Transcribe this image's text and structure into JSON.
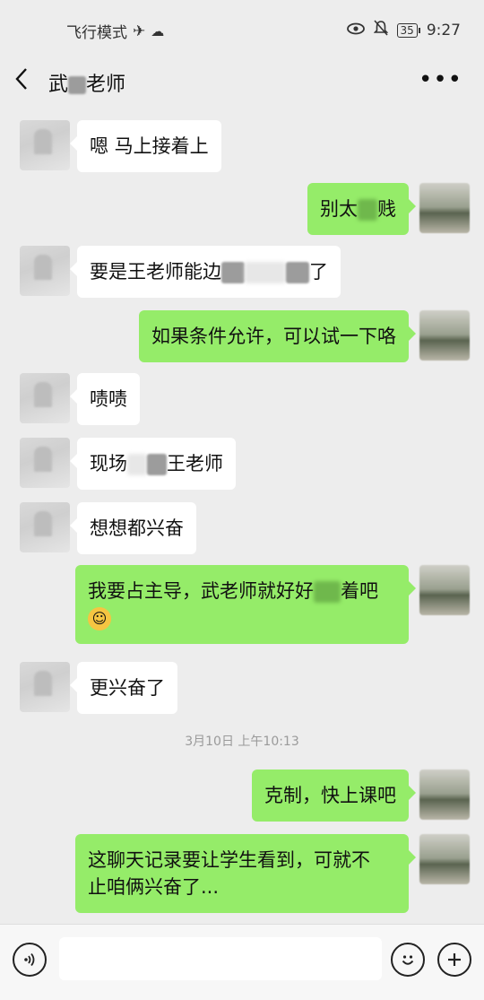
{
  "status_bar": {
    "airplane_mode": "飞行模式",
    "time": "9:27",
    "battery": "35",
    "icons": [
      "airplane-icon",
      "cloud-icon",
      "eye-icon",
      "mute-icon",
      "battery-icon"
    ]
  },
  "header": {
    "title": "武",
    "title_end": "老师",
    "icons": [
      "back-arrow-icon",
      "more-icon"
    ]
  },
  "messages": [
    {
      "side": "in",
      "text": "嗯 马上接着上"
    },
    {
      "side": "out",
      "text_a": "别太",
      "text_b": "贱"
    },
    {
      "side": "in",
      "text_a": "要是王老师能边",
      "text_b": "了"
    },
    {
      "side": "out",
      "text": "如果条件允许，可以试一下咯"
    },
    {
      "side": "in",
      "text": "啧啧"
    },
    {
      "side": "in",
      "text_a": "现场",
      "text_b": "王老师"
    },
    {
      "side": "in",
      "text": "想想都兴奋"
    },
    {
      "side": "out",
      "text_a": "我要占主导，武老师就好好",
      "text_b": "着吧",
      "emoji": "☺"
    },
    {
      "side": "in",
      "text": "更兴奋了"
    },
    {
      "side": "out",
      "text": "克制，快上课吧"
    },
    {
      "side": "out",
      "text_line1": "这聊天记录要让学生看到，可就不",
      "text_line2": "止咱俩兴奋了..."
    }
  ],
  "timestamp": "3月10日 上午10:13",
  "input_bar": {
    "icons": [
      "voice-icon",
      "emoji-icon",
      "plus-icon"
    ]
  }
}
